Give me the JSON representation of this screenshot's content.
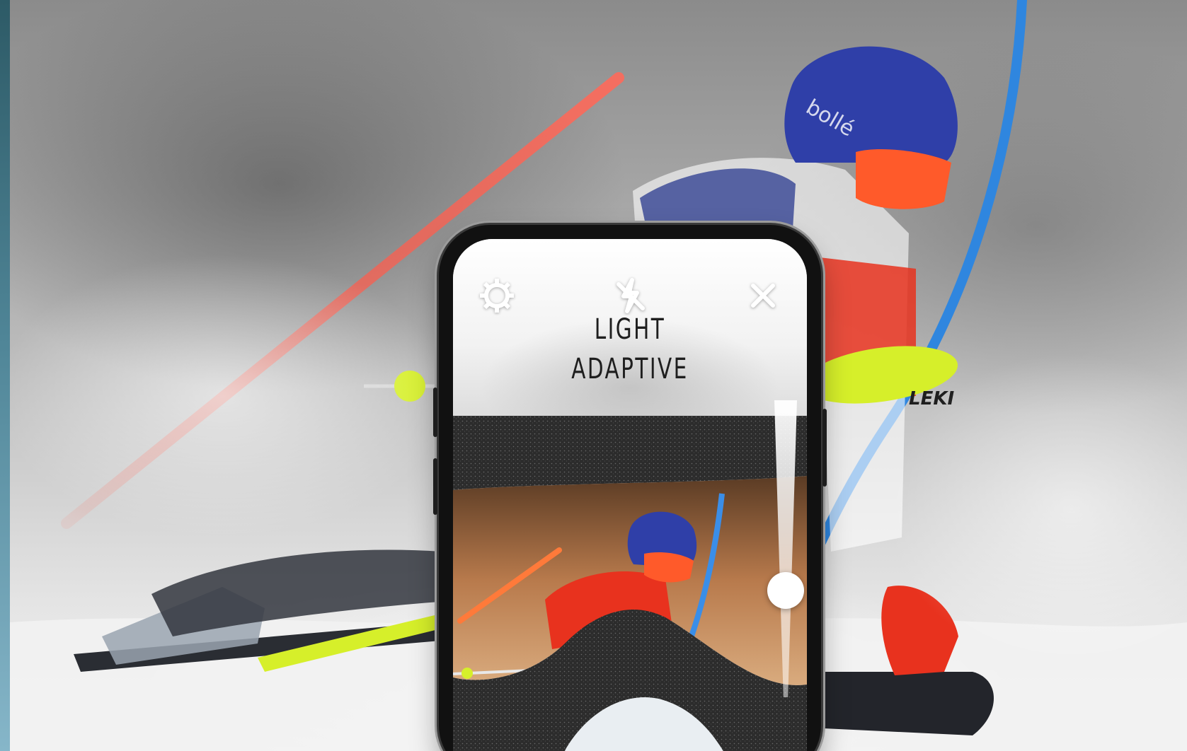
{
  "app": {
    "mode_title_line1": "LIGHT",
    "mode_title_line2": "ADAPTIVE"
  },
  "toolbar": {
    "settings_icon": "gear-icon",
    "flash_off_icon": "flash-off-icon",
    "close_icon": "close-icon"
  },
  "tint_slider": {
    "level": 0.66
  },
  "brand_marks": {
    "helmet_logo": "bollé",
    "ski_pole_logo": "LEKI"
  },
  "colors": {
    "gate_red": "#ff5a4a",
    "gate_blue": "#2f86df",
    "pole_yellow": "#d6ef2a",
    "suit_red": "#e8321e",
    "suit_blue": "#2a3a8f"
  }
}
